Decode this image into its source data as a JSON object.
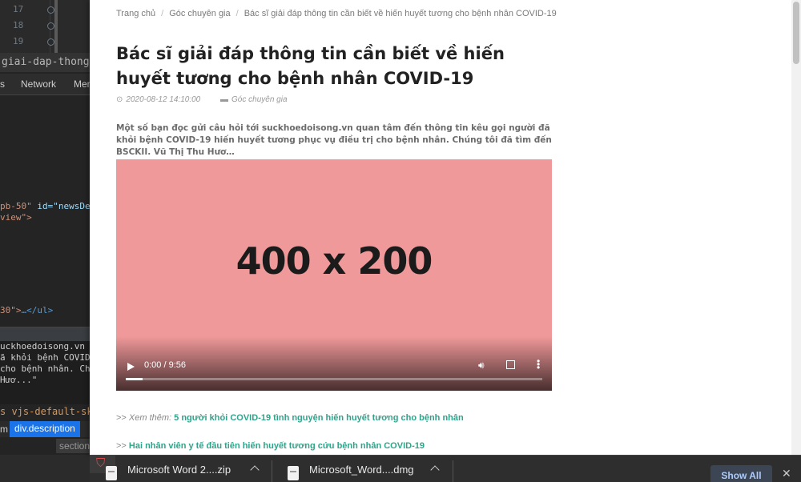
{
  "devtools": {
    "line_numbers": [
      "17",
      "18",
      "19"
    ],
    "file_tab": "giai-dap-thong-tin",
    "tabs": [
      "s",
      "Network",
      "Mem"
    ],
    "code_lines": [
      {
        "attr": "pb-50\"",
        "rest": " id=\"newsDe"
      },
      {
        "attr": "view\">",
        "rest": ""
      },
      {
        "attr": "30\">",
        "rest": "…</ul>"
      }
    ],
    "console_lines": [
      "uckhoedoisong.vn q",
      "ã khỏi bệnh COVID-",
      " cho bệnh nhân. Ch",
      " Hươ...\""
    ],
    "vjs_line": "s vjs-default-ski",
    "breadcrumb_tail": "m",
    "breadcrumb_selected": "div.description",
    "section_label": "section"
  },
  "article": {
    "breadcrumb": [
      "Trang chủ",
      "Góc chuyên gia",
      "Bác sĩ giải đáp thông tin cần biết về hiến huyết tương cho bệnh nhân COVID-19"
    ],
    "title": "Bác sĩ giải đáp thông tin cần biết về hiến huyết tương cho bệnh nhân COVID-19",
    "date": "2020-08-12 14:10:00",
    "category": "Góc chuyên gia",
    "summary": "Một số bạn đọc gửi câu hỏi tới suckhoedoisong.vn quan tâm đến thông tin kêu gọi người đã khỏi bệnh COVID-19 hiến huyết tương phục vụ điều trị cho bệnh nhân. Chúng tôi đã tìm đến BSCKII. Vũ Thị Thu Hươ…",
    "video": {
      "placeholder_text": "400 x 200",
      "time": "0:00 / 9:56",
      "progress": 0.04,
      "background_color": "#f0999a"
    },
    "related": [
      {
        "prefix": ">> ",
        "label": "Xem thêm:",
        "link": "5 người khỏi COVID-19 tình nguyện hiến huyết tương cho bệnh nhân"
      },
      {
        "prefix": ">> ",
        "label": "",
        "link": "Hai nhân viên y tế đầu tiên hiến huyết tương cứu bệnh nhân COVID-19"
      }
    ]
  },
  "downloads": {
    "items": [
      {
        "name": "Microsoft Word 2....zip",
        "icon": "file-icon"
      },
      {
        "name": "Microsoft_Word....dmg",
        "icon": "file-icon"
      }
    ],
    "show_all_label": "Show All",
    "close_icon": "✕"
  },
  "colors": {
    "link": "#2fa38a",
    "show_all_text": "#aecbfa"
  }
}
